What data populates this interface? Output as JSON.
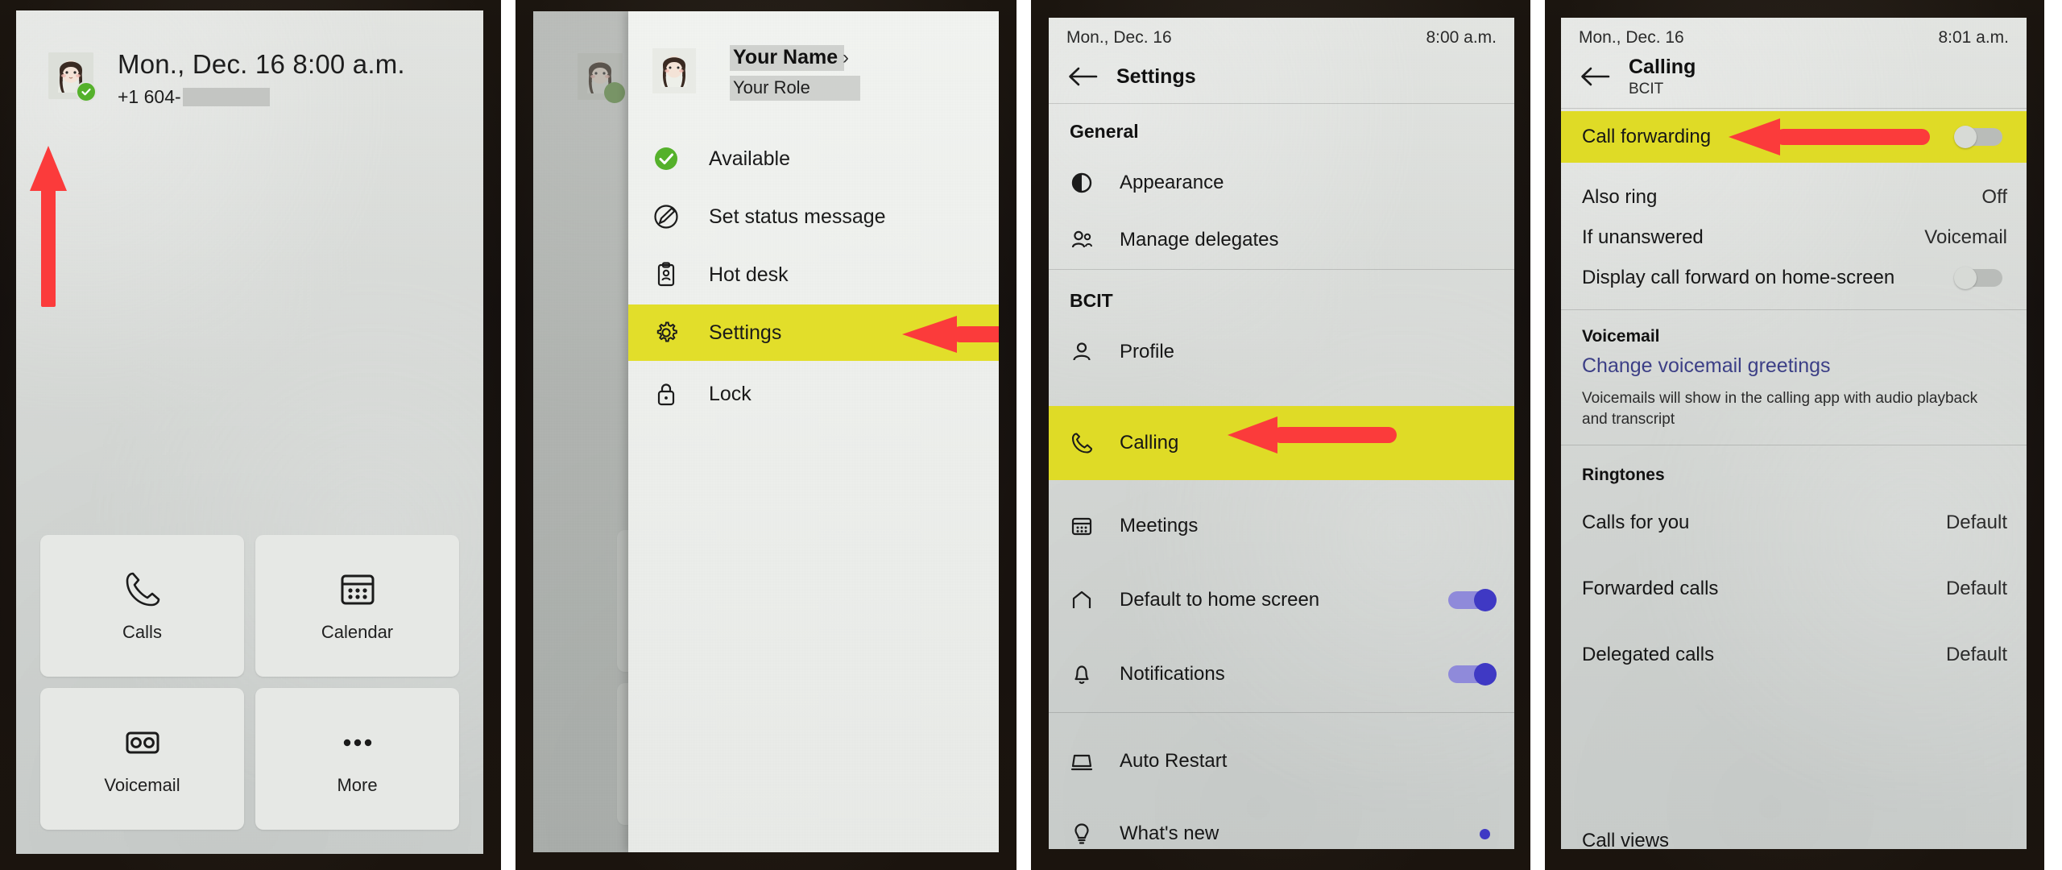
{
  "panel1": {
    "name": "home-screen",
    "status_time": "Mon., Dec. 16 8:00 a.m.",
    "phone_number_prefix": "+1 604-",
    "presence": "available",
    "tiles": [
      {
        "label": "Calls",
        "icon": "phone-icon"
      },
      {
        "label": "Calendar",
        "icon": "calendar-icon"
      },
      {
        "label": "Voicemail",
        "icon": "voicemail-icon"
      },
      {
        "label": "More",
        "icon": "ellipsis-icon"
      }
    ],
    "annotation": {
      "type": "arrow-up",
      "color": "#fb3b3b",
      "points_to": "avatar"
    }
  },
  "panel2": {
    "name": "profile-drawer",
    "profile": {
      "name": "Your Name",
      "role": "Your Role",
      "chevron": "›"
    },
    "items": [
      {
        "label": "Available",
        "icon": "available-check-icon",
        "highlighted": false
      },
      {
        "label": "Set status message",
        "icon": "pencil-circle-icon",
        "highlighted": false
      },
      {
        "label": "Hot desk",
        "icon": "hot-desk-icon",
        "highlighted": false
      },
      {
        "label": "Settings",
        "icon": "gear-icon",
        "highlighted": true
      },
      {
        "label": "Lock",
        "icon": "lock-icon",
        "highlighted": false
      }
    ],
    "annotation": {
      "type": "arrow-left",
      "color": "#fb3b3b",
      "points_to": "Settings"
    },
    "highlight_color": "#e2de2a"
  },
  "panel3": {
    "name": "settings-screen",
    "status_date": "Mon., Dec. 16",
    "status_time": "8:00 a.m.",
    "nav_title": "Settings",
    "sections": [
      {
        "title": "General",
        "rows": [
          {
            "label": "Appearance",
            "icon": "appearance-icon",
            "control": "none"
          },
          {
            "label": "Manage delegates",
            "icon": "people-icon",
            "control": "none"
          }
        ]
      },
      {
        "title": "BCIT",
        "rows": [
          {
            "label": "Profile",
            "icon": "person-icon",
            "control": "none",
            "highlighted": false
          },
          {
            "label": "Calling",
            "icon": "phone-icon",
            "control": "none",
            "highlighted": true
          },
          {
            "label": "Meetings",
            "icon": "calendar-icon",
            "control": "none",
            "highlighted": false
          },
          {
            "label": "Default to home screen",
            "icon": "home-icon",
            "control": "toggle",
            "toggle_on": true
          },
          {
            "label": "Notifications",
            "icon": "bell-icon",
            "control": "toggle",
            "toggle_on": true
          }
        ]
      },
      {
        "title": "",
        "rows": [
          {
            "label": "Auto Restart",
            "icon": "device-icon",
            "control": "none"
          },
          {
            "label": "What's new",
            "icon": "lightbulb-icon",
            "control": "dot"
          }
        ]
      }
    ],
    "annotation": {
      "type": "arrow-left",
      "color": "#fb3b3b",
      "points_to": "Calling"
    },
    "highlight_color": "#dfdb26",
    "toggle_on_color": "#3f39c4"
  },
  "panel4": {
    "name": "calling-settings-screen",
    "status_date": "Mon., Dec. 16",
    "status_time": "8:01 a.m.",
    "nav_title": "Calling",
    "nav_subtitle": "BCIT",
    "rows": [
      {
        "label": "Call forwarding",
        "control": "toggle",
        "toggle_on": false,
        "highlighted": true
      },
      {
        "label": "Also ring",
        "value": "Off",
        "control": "value"
      },
      {
        "label": "If unanswered",
        "value": "Voicemail",
        "control": "value"
      },
      {
        "label": "Display call forward on home-screen",
        "control": "toggle",
        "toggle_on": false
      }
    ],
    "voicemail_section": {
      "title": "Voicemail",
      "link": "Change voicemail greetings",
      "description": "Voicemails will show in the calling app with audio playback and transcript"
    },
    "ringtones_section": {
      "title": "Ringtones",
      "rows": [
        {
          "label": "Calls for you",
          "value": "Default"
        },
        {
          "label": "Forwarded calls",
          "value": "Default"
        },
        {
          "label": "Delegated calls",
          "value": "Default"
        }
      ],
      "cutoff_row": "Call views"
    },
    "annotation": {
      "type": "arrow-left",
      "color": "#fb3b3b",
      "points_to": "Call forwarding"
    },
    "highlight_color": "#dfdb26"
  }
}
